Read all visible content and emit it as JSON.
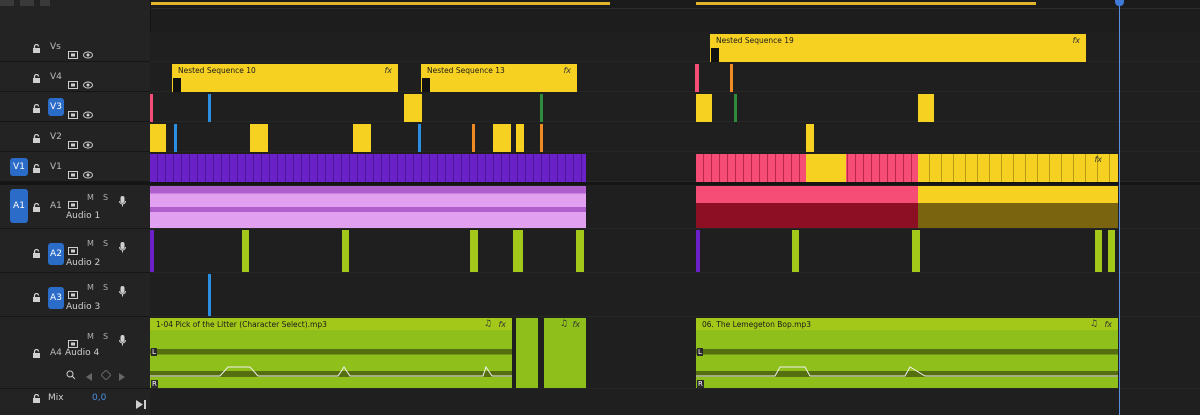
{
  "tracks": {
    "v5": {
      "tag": "Vs"
    },
    "v4": {
      "tag": "V4"
    },
    "v3": {
      "tag": "V3"
    },
    "v2": {
      "tag": "V2"
    },
    "v1": {
      "tag": "V1",
      "target": "V1"
    },
    "a1": {
      "tag": "A1",
      "target": "A1",
      "name": "Audio 1"
    },
    "a2": {
      "tag": "A2",
      "name": "Audio 2"
    },
    "a3": {
      "tag": "A3",
      "name": "Audio 3"
    },
    "a4": {
      "tag": "A4",
      "name": "Audio 4"
    },
    "mix": {
      "name": "Mix",
      "value": "0,0"
    }
  },
  "toggles": {
    "mute": "M",
    "solo": "S"
  },
  "clips": {
    "nested19": "Nested Sequence 19",
    "nested10": "Nested Sequence 10",
    "nested13": "Nested Sequence 13",
    "audio_pick": "1-04 Pick of the Litter (Character Select).mp3",
    "audio_lemegeton": "06. The Lemegeton Bop.mp3",
    "fx": "fx",
    "channel_left": "L",
    "channel_right": "R",
    "note_icon": "♫"
  },
  "colors": {
    "nested": "#f6d122",
    "video_purple": "#6a22c8",
    "video_red": "#f54d75",
    "audio_purple": "#d57ce8",
    "audio_green": "#a4c81a",
    "target_blue": "#2b6cc8"
  }
}
